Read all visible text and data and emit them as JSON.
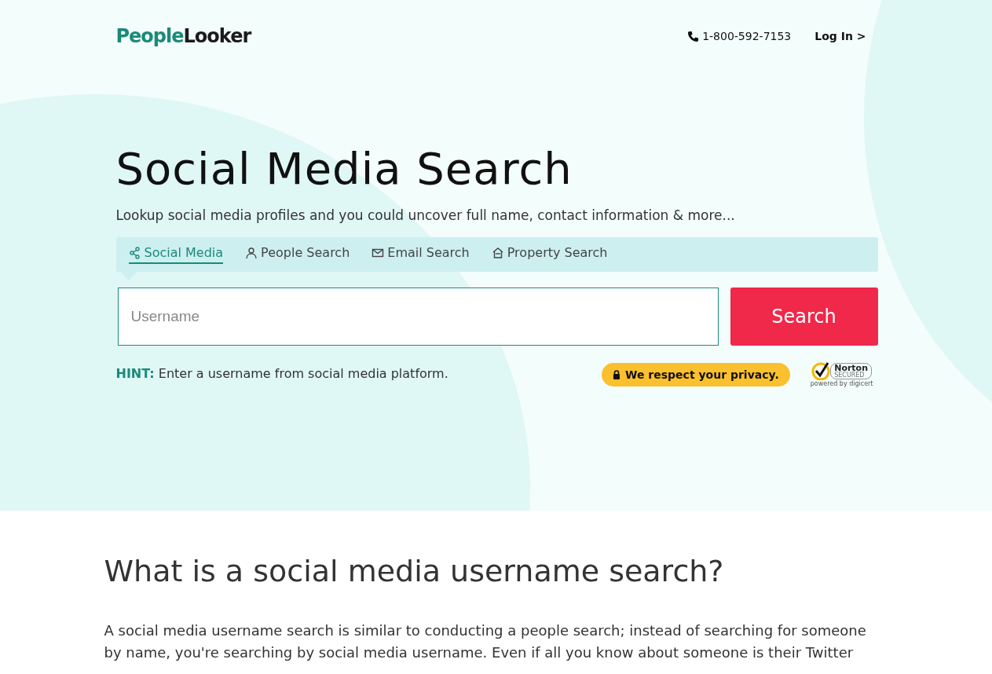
{
  "header": {
    "logo": {
      "part_1": "People",
      "part_2": "Looker"
    },
    "phone": "1-800-592-7153",
    "login": "Log In >"
  },
  "hero": {
    "title": "Social Media Search",
    "subtitle": "Lookup social media profiles and you could uncover full name, contact information & more...",
    "tabs": [
      {
        "label": "Social Media",
        "selected": true
      },
      {
        "label": "People Search",
        "selected": false
      },
      {
        "label": "Email Search",
        "selected": false
      },
      {
        "label": "Property Search",
        "selected": false
      }
    ],
    "search": {
      "placeholder": "Username",
      "button": "Search"
    },
    "hint": {
      "label": "HINT:",
      "text": "Enter a username from social media platform."
    },
    "privacy": "We respect your privacy.",
    "norton": {
      "name": "Norton",
      "status": "SECURED",
      "powered": "powered by digicert"
    }
  },
  "article": {
    "heading": "What is a social media username search?",
    "paragraph": "A social media username search is similar to conducting a people search; instead of searching for someone by name, you're searching by social media username. Even if all you know about someone is their Twitter"
  }
}
